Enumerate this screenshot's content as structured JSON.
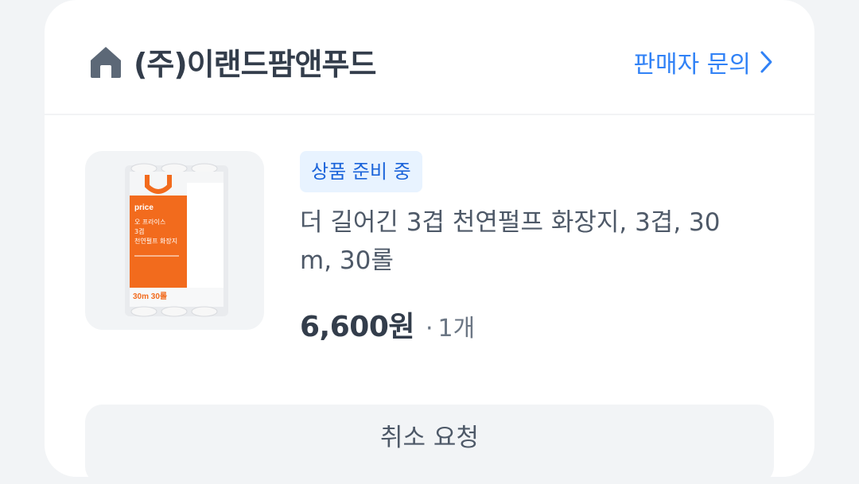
{
  "seller": {
    "name": "(주)이랜드팜앤푸드",
    "inquiry_label": "판매자 문의",
    "icon": "home-icon"
  },
  "order_item": {
    "status": "상품 준비 중",
    "title": "더 길어긴 3겹 천연펄프 화장지, 3겹, 30 m, 30롤",
    "price": "6,600원",
    "separator": "·",
    "quantity": "1개",
    "image_text": {
      "brand": "price",
      "line1": "오 프라이스",
      "line2": "3겹",
      "line3": "천연펄프 화장지",
      "count": "30m 30롤"
    }
  },
  "actions": {
    "cancel_label": "취소 요청"
  },
  "colors": {
    "accent": "#3182f6",
    "badge_bg": "#e8f3ff",
    "badge_text": "#1b64da",
    "product_orange": "#f26b1d"
  }
}
